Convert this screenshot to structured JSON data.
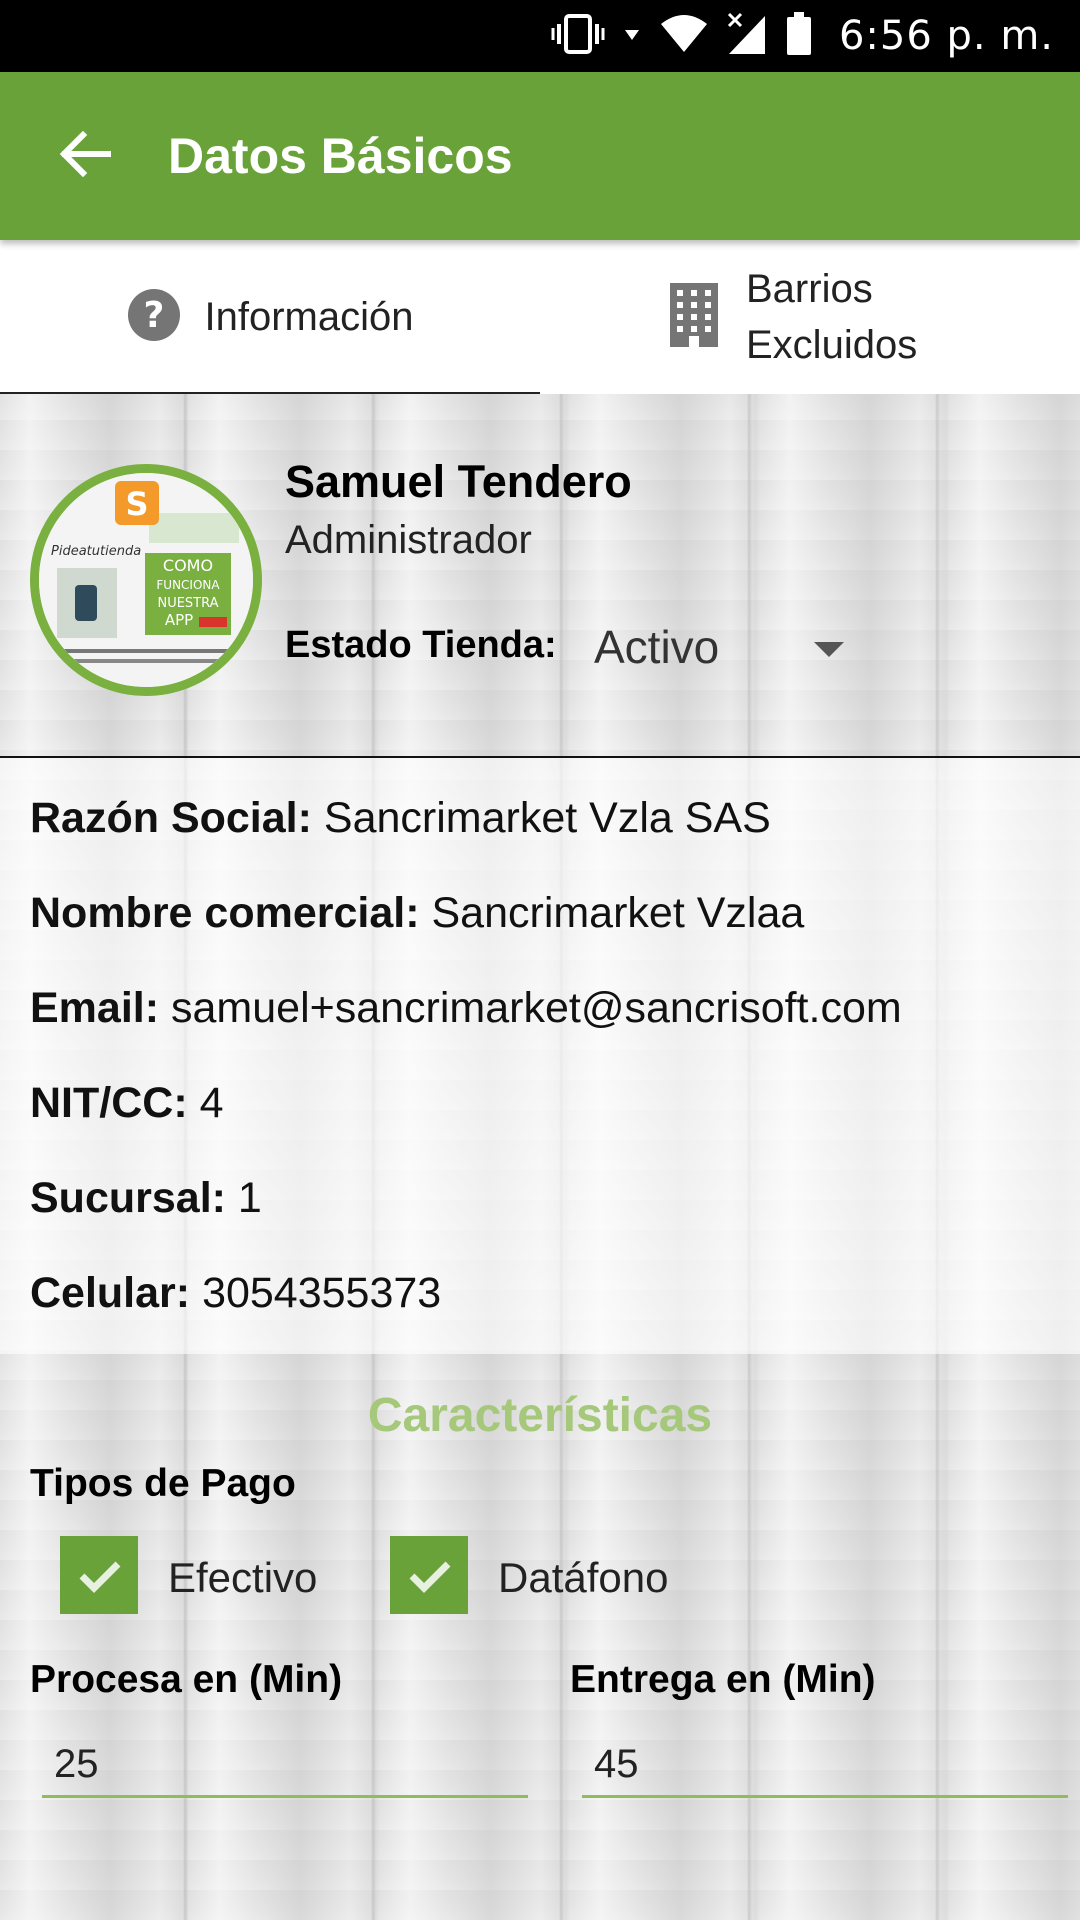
{
  "status_bar": {
    "time": "6:56 p. m."
  },
  "app_bar": {
    "title": "Datos Básicos"
  },
  "tabs": [
    {
      "label": "Información",
      "icon": "help-circle-icon",
      "active": true
    },
    {
      "label": "Barrios\nExcluidos",
      "icon": "building-icon",
      "active": false
    }
  ],
  "profile": {
    "name": "Samuel Tendero",
    "role": "Administrador",
    "estado_label": "Estado Tienda:",
    "estado_value": "Activo",
    "avatar": {
      "brand": "Pideatutienda",
      "lines": [
        "COMO",
        "FUNCIONA",
        "NUESTRA",
        "APP"
      ]
    }
  },
  "details": {
    "razon_social": {
      "label": "Razón Social:",
      "value": "Sancrimarket Vzla SAS"
    },
    "nombre_comercial": {
      "label": "Nombre comercial:",
      "value": "Sancrimarket Vzlaa"
    },
    "email": {
      "label": "Email:",
      "value": "samuel+sancrimarket@sancrisoft.com"
    },
    "nit": {
      "label": "NIT/CC:",
      "value": "4"
    },
    "sucursal": {
      "label": "Sucursal:",
      "value": "1"
    },
    "celular": {
      "label": "Celular:",
      "value": "3054355373"
    }
  },
  "features": {
    "title": "Características",
    "payment_label": "Tipos de Pago",
    "payments": [
      {
        "label": "Efectivo",
        "checked": true
      },
      {
        "label": "Datáfono",
        "checked": true
      }
    ],
    "procesa": {
      "label": "Procesa en (Min)",
      "value": "25"
    },
    "entrega": {
      "label": "Entrega en (Min)",
      "value": "45"
    }
  },
  "colors": {
    "primary": "#6aa23a",
    "accent_light": "#a6c87a"
  }
}
